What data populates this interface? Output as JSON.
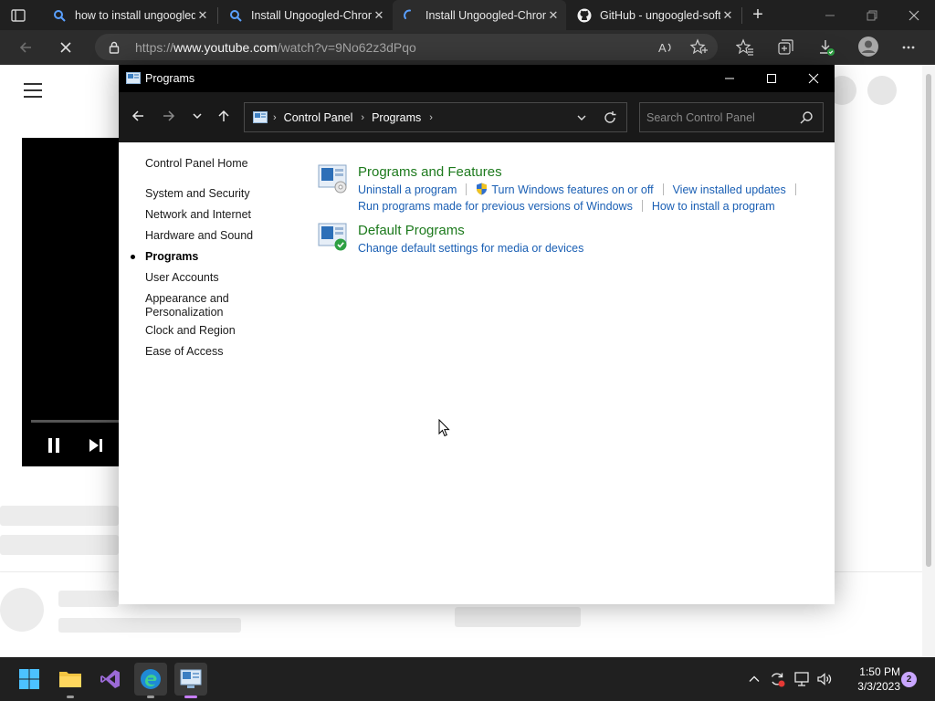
{
  "browser": {
    "tabs": [
      {
        "title": "how to install ungoogled-chromium",
        "icon": "search-icon"
      },
      {
        "title": "Install Ungoogled-Chromium",
        "icon": "search-icon"
      },
      {
        "title": "Install Ungoogled-Chromium",
        "icon": "loading-icon",
        "active": true
      },
      {
        "title": "GitHub - ungoogled-software",
        "icon": "github-icon"
      }
    ],
    "close_glyph": "✕",
    "new_tab_glyph": "+",
    "url_prefix": "https://",
    "url_host": "www.youtube.com",
    "url_path": "/watch?v=9No62z3dPqo"
  },
  "window": {
    "title": "Programs",
    "caption_minimize": "—",
    "caption_maximize": "☐",
    "caption_close": "✕",
    "breadcrumb": [
      "Control Panel",
      "Programs"
    ],
    "breadcrumb_separator": "›",
    "search_placeholder": "Search Control Panel"
  },
  "sidebar": {
    "home": "Control Panel Home",
    "items": [
      {
        "label": "System and Security"
      },
      {
        "label": "Network and Internet"
      },
      {
        "label": "Hardware and Sound"
      },
      {
        "label": "Programs",
        "active": true
      },
      {
        "label": "User Accounts"
      },
      {
        "label": "Appearance and Personalization"
      },
      {
        "label": "Clock and Region"
      },
      {
        "label": "Ease of Access"
      }
    ]
  },
  "categories": [
    {
      "title": "Programs and Features",
      "links": [
        "Uninstall a program",
        "Turn Windows features on or off",
        "View installed updates",
        "Run programs made for previous versions of Windows",
        "How to install a program"
      ]
    },
    {
      "title": "Default Programs",
      "links": [
        "Change default settings for media or devices"
      ]
    }
  ],
  "taskbar": {
    "time": "1:50 PM",
    "date": "3/3/2023",
    "notification_count": "2"
  },
  "colors": {
    "category_title": "#1d7a1d",
    "link": "#1a5fb4",
    "titlebar": "#000000",
    "taskbar": "#202020"
  }
}
